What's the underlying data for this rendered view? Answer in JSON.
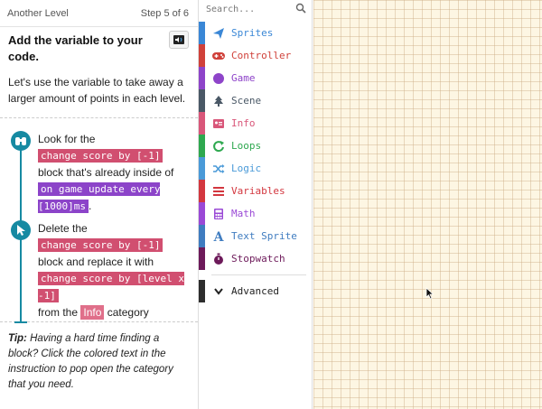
{
  "header": {
    "level_name": "Another Level",
    "step_label": "Step 5 of 6"
  },
  "instruction": {
    "title": "Add the variable to your code.",
    "intro": "Let's use the variable to take away a larger amount of points in each level."
  },
  "steps": [
    {
      "icon": "binoculars-icon",
      "text_1": "Look for the",
      "chip_1": "change score by [-1]",
      "text_2": "block that's already inside of",
      "chip_2": "on game update every [1000]ms",
      "text_3": "."
    },
    {
      "icon": "cursor-icon",
      "text_1": "Delete the",
      "chip_1": "change score by [-1]",
      "text_2": "block and replace it with",
      "chip_2": "change score by [level x -1]",
      "text_3": "from the",
      "chip_3": "Info",
      "text_4": "category"
    }
  ],
  "tip": {
    "label": "Tip:",
    "text": "Having a hard time finding a block? Click the colored text in the instruction to pop open the category that you need."
  },
  "toolbox": {
    "search_placeholder": "Search...",
    "categories": [
      {
        "label": "Sprites",
        "color": "#3a87d6",
        "icon": "paper-plane-icon"
      },
      {
        "label": "Controller",
        "color": "#d0413a",
        "icon": "gamepad-icon"
      },
      {
        "label": "Game",
        "color": "#8e44c9",
        "icon": "circle-icon"
      },
      {
        "label": "Scene",
        "color": "#4a5866",
        "icon": "tree-icon"
      },
      {
        "label": "Info",
        "color": "#d9577a",
        "icon": "id-card-icon"
      },
      {
        "label": "Loops",
        "color": "#2ea84f",
        "icon": "refresh-icon"
      },
      {
        "label": "Logic",
        "color": "#4a9ad8",
        "icon": "shuffle-icon"
      },
      {
        "label": "Variables",
        "color": "#d3373f",
        "icon": "list-icon"
      },
      {
        "label": "Math",
        "color": "#9a49d6",
        "icon": "calculator-icon"
      },
      {
        "label": "Text Sprite",
        "color": "#3f7cc0",
        "icon": "text-a-icon"
      },
      {
        "label": "Stopwatch",
        "color": "#6d1a5a",
        "icon": "stopwatch-icon"
      }
    ],
    "advanced": {
      "label": "Advanced",
      "color": "#2d2d2d",
      "icon": "chevron-down-icon"
    }
  }
}
